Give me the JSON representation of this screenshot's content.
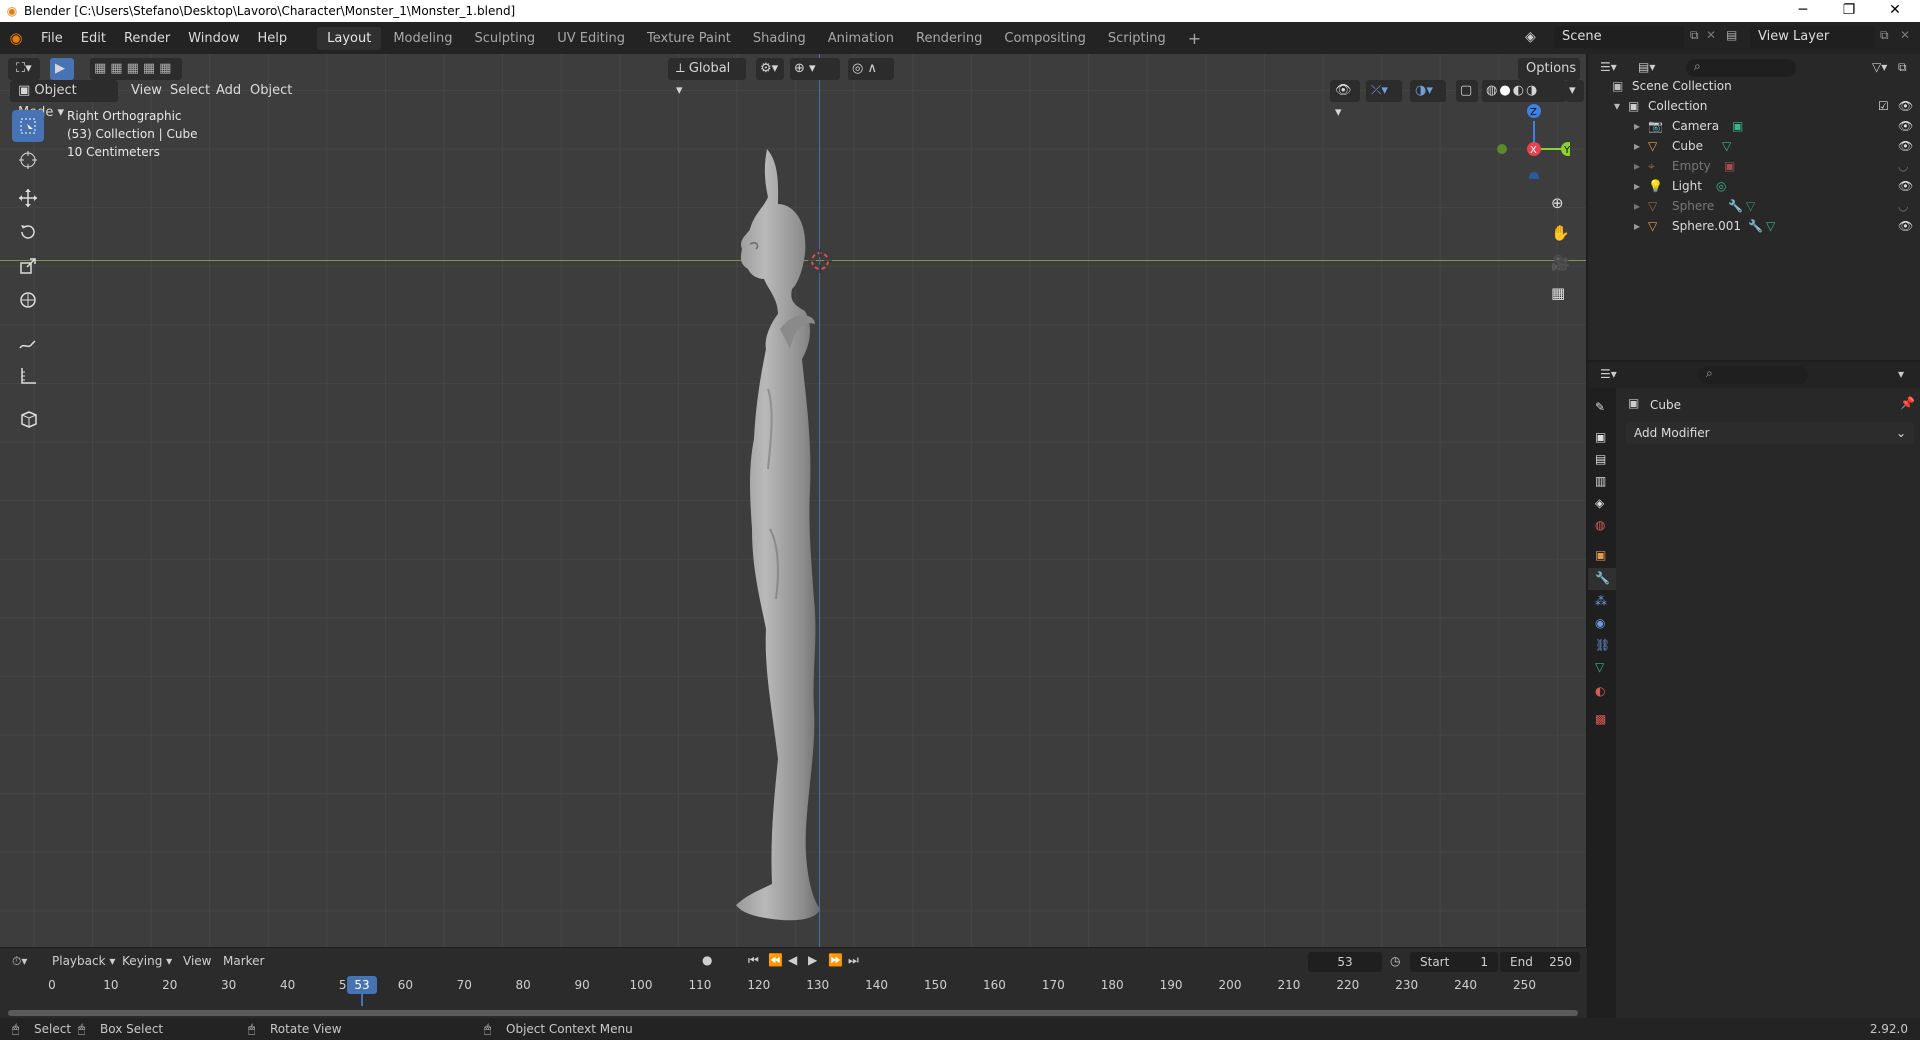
{
  "window": {
    "title": "Blender [C:\\Users\\Stefano\\Desktop\\Lavoro\\Character\\Monster_1\\Monster_1.blend]",
    "minimize": "─",
    "restore": "❐",
    "close": "✕"
  },
  "topbar": {
    "menus": [
      "File",
      "Edit",
      "Render",
      "Window",
      "Help"
    ],
    "workspaces": [
      "Layout",
      "Modeling",
      "Sculpting",
      "UV Editing",
      "Texture Paint",
      "Shading",
      "Animation",
      "Rendering",
      "Compositing",
      "Scripting"
    ],
    "active_workspace": "Layout",
    "add_workspace": "+",
    "scene": "Scene",
    "view_layer": "View Layer"
  },
  "viewport": {
    "mode": "Object Mode",
    "menus": [
      "View",
      "Select",
      "Add",
      "Object"
    ],
    "orientation": "Global",
    "options": "Options",
    "info_view": "Right Orthographic",
    "info_collection": "(53) Collection | Cube",
    "info_scale": "10 Centimeters",
    "gizmo": {
      "z": "Z",
      "x": "X",
      "y": "Y"
    },
    "colors": {
      "bg": "#3d3d3d",
      "x_axis": "#e6424f",
      "y_axis": "#8bd130",
      "z_axis": "#3c82e5",
      "active": "#4772b3"
    }
  },
  "outliner": {
    "root": "Scene Collection",
    "collection": "Collection",
    "items": [
      {
        "name": "Camera",
        "dim": false,
        "visible": true
      },
      {
        "name": "Cube",
        "dim": false,
        "visible": true
      },
      {
        "name": "Empty",
        "dim": true,
        "visible": false
      },
      {
        "name": "Light",
        "dim": false,
        "visible": true
      },
      {
        "name": "Sphere",
        "dim": true,
        "visible": false
      },
      {
        "name": "Sphere.001",
        "dim": false,
        "visible": true
      }
    ]
  },
  "properties": {
    "object_name": "Cube",
    "add_modifier": "Add Modifier"
  },
  "timeline": {
    "menus": [
      "Playback",
      "Keying",
      "View",
      "Marker"
    ],
    "current_frame": "53",
    "start_label": "Start",
    "start": "1",
    "end_label": "End",
    "end": "250",
    "ticks": [
      "0",
      "10",
      "20",
      "30",
      "40",
      "50",
      "60",
      "70",
      "80",
      "90",
      "100",
      "110",
      "120",
      "130",
      "140",
      "150",
      "160",
      "170",
      "180",
      "190",
      "200",
      "210",
      "220",
      "230",
      "240",
      "250"
    ]
  },
  "statusbar": {
    "select": "Select",
    "box_select": "Box Select",
    "rotate_view": "Rotate View",
    "context_menu": "Object Context Menu",
    "version": "2.92.0"
  }
}
